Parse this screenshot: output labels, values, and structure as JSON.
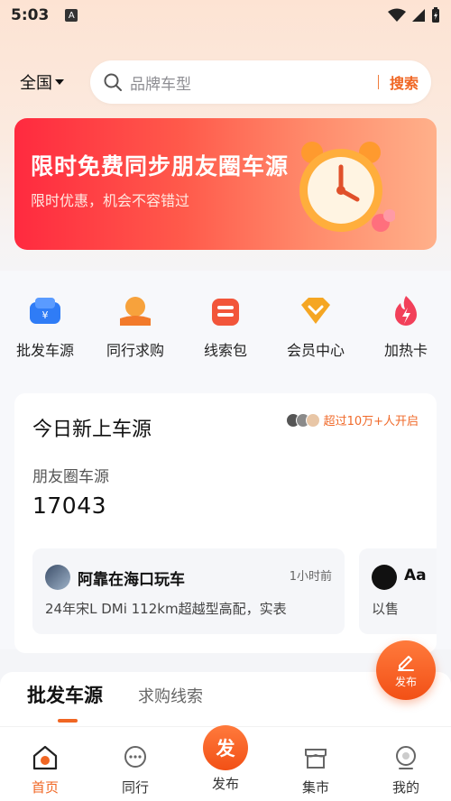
{
  "status_bar": {
    "time": "5:03",
    "notif_icon": "A"
  },
  "header": {
    "region": "全国",
    "search_placeholder": "品牌车型",
    "search_button": "搜索"
  },
  "banner": {
    "title": "限时免费同步朋友圈车源",
    "subtitle": "限时优惠，机会不容错过"
  },
  "quick_actions": [
    {
      "label": "批发车源",
      "icon": "car-tag-icon",
      "color": "#2f7cf6"
    },
    {
      "label": "同行求购",
      "icon": "hand-coin-icon",
      "color": "#f27a2a"
    },
    {
      "label": "线索包",
      "icon": "clue-package-icon",
      "color": "#f2553a"
    },
    {
      "label": "会员中心",
      "icon": "vip-diamond-icon",
      "color": "#f5a623"
    },
    {
      "label": "加热卡",
      "icon": "flame-icon",
      "color": "#f2405a"
    }
  ],
  "today_card": {
    "title": "今日新上车源",
    "badge_text": "超过10万+人开启",
    "label": "朋友圈车源",
    "count": "17043",
    "posts": [
      {
        "name": "阿靠在海口玩车",
        "time": "1小时前",
        "text": "24年宋L DMi 112km超越型高配，实表"
      },
      {
        "name": "Aa",
        "time": "",
        "text": "以售"
      }
    ]
  },
  "tabs": {
    "active": "批发车源",
    "inactive": "求购线索"
  },
  "fab": {
    "label": "发布"
  },
  "bottom_nav": [
    {
      "label": "首页",
      "icon": "home-icon",
      "active": true
    },
    {
      "label": "同行",
      "icon": "chat-icon",
      "active": false
    },
    {
      "label": "发布",
      "icon": "publish-icon",
      "active": false,
      "circle_text": "发"
    },
    {
      "label": "集市",
      "icon": "market-icon",
      "active": false
    },
    {
      "label": "我的",
      "icon": "profile-icon",
      "active": false
    }
  ],
  "colors": {
    "accent": "#f06623",
    "banner_red": "#ff2a3f"
  }
}
